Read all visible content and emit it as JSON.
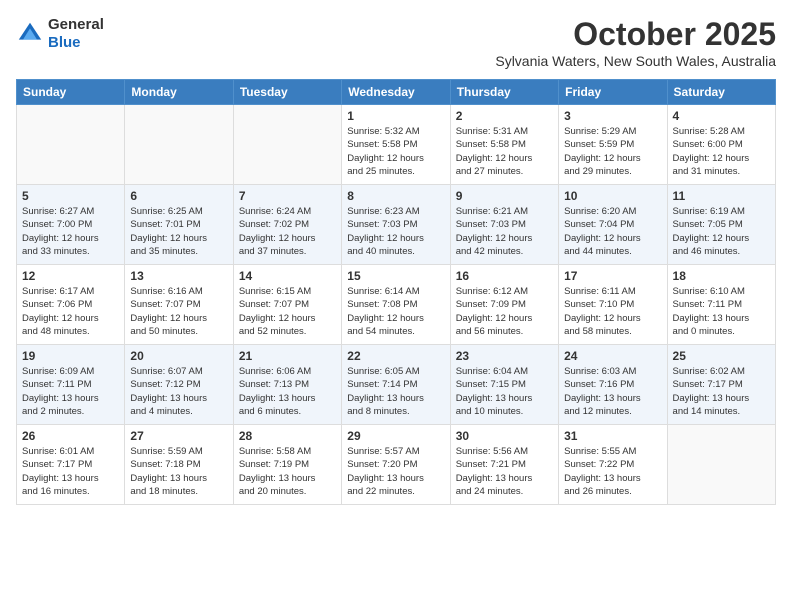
{
  "header": {
    "logo_general": "General",
    "logo_blue": "Blue",
    "month": "October 2025",
    "location": "Sylvania Waters, New South Wales, Australia"
  },
  "weekdays": [
    "Sunday",
    "Monday",
    "Tuesday",
    "Wednesday",
    "Thursday",
    "Friday",
    "Saturday"
  ],
  "weeks": [
    [
      {
        "day": "",
        "info": ""
      },
      {
        "day": "",
        "info": ""
      },
      {
        "day": "",
        "info": ""
      },
      {
        "day": "1",
        "info": "Sunrise: 5:32 AM\nSunset: 5:58 PM\nDaylight: 12 hours\nand 25 minutes."
      },
      {
        "day": "2",
        "info": "Sunrise: 5:31 AM\nSunset: 5:58 PM\nDaylight: 12 hours\nand 27 minutes."
      },
      {
        "day": "3",
        "info": "Sunrise: 5:29 AM\nSunset: 5:59 PM\nDaylight: 12 hours\nand 29 minutes."
      },
      {
        "day": "4",
        "info": "Sunrise: 5:28 AM\nSunset: 6:00 PM\nDaylight: 12 hours\nand 31 minutes."
      }
    ],
    [
      {
        "day": "5",
        "info": "Sunrise: 6:27 AM\nSunset: 7:00 PM\nDaylight: 12 hours\nand 33 minutes."
      },
      {
        "day": "6",
        "info": "Sunrise: 6:25 AM\nSunset: 7:01 PM\nDaylight: 12 hours\nand 35 minutes."
      },
      {
        "day": "7",
        "info": "Sunrise: 6:24 AM\nSunset: 7:02 PM\nDaylight: 12 hours\nand 37 minutes."
      },
      {
        "day": "8",
        "info": "Sunrise: 6:23 AM\nSunset: 7:03 PM\nDaylight: 12 hours\nand 40 minutes."
      },
      {
        "day": "9",
        "info": "Sunrise: 6:21 AM\nSunset: 7:03 PM\nDaylight: 12 hours\nand 42 minutes."
      },
      {
        "day": "10",
        "info": "Sunrise: 6:20 AM\nSunset: 7:04 PM\nDaylight: 12 hours\nand 44 minutes."
      },
      {
        "day": "11",
        "info": "Sunrise: 6:19 AM\nSunset: 7:05 PM\nDaylight: 12 hours\nand 46 minutes."
      }
    ],
    [
      {
        "day": "12",
        "info": "Sunrise: 6:17 AM\nSunset: 7:06 PM\nDaylight: 12 hours\nand 48 minutes."
      },
      {
        "day": "13",
        "info": "Sunrise: 6:16 AM\nSunset: 7:07 PM\nDaylight: 12 hours\nand 50 minutes."
      },
      {
        "day": "14",
        "info": "Sunrise: 6:15 AM\nSunset: 7:07 PM\nDaylight: 12 hours\nand 52 minutes."
      },
      {
        "day": "15",
        "info": "Sunrise: 6:14 AM\nSunset: 7:08 PM\nDaylight: 12 hours\nand 54 minutes."
      },
      {
        "day": "16",
        "info": "Sunrise: 6:12 AM\nSunset: 7:09 PM\nDaylight: 12 hours\nand 56 minutes."
      },
      {
        "day": "17",
        "info": "Sunrise: 6:11 AM\nSunset: 7:10 PM\nDaylight: 12 hours\nand 58 minutes."
      },
      {
        "day": "18",
        "info": "Sunrise: 6:10 AM\nSunset: 7:11 PM\nDaylight: 13 hours\nand 0 minutes."
      }
    ],
    [
      {
        "day": "19",
        "info": "Sunrise: 6:09 AM\nSunset: 7:11 PM\nDaylight: 13 hours\nand 2 minutes."
      },
      {
        "day": "20",
        "info": "Sunrise: 6:07 AM\nSunset: 7:12 PM\nDaylight: 13 hours\nand 4 minutes."
      },
      {
        "day": "21",
        "info": "Sunrise: 6:06 AM\nSunset: 7:13 PM\nDaylight: 13 hours\nand 6 minutes."
      },
      {
        "day": "22",
        "info": "Sunrise: 6:05 AM\nSunset: 7:14 PM\nDaylight: 13 hours\nand 8 minutes."
      },
      {
        "day": "23",
        "info": "Sunrise: 6:04 AM\nSunset: 7:15 PM\nDaylight: 13 hours\nand 10 minutes."
      },
      {
        "day": "24",
        "info": "Sunrise: 6:03 AM\nSunset: 7:16 PM\nDaylight: 13 hours\nand 12 minutes."
      },
      {
        "day": "25",
        "info": "Sunrise: 6:02 AM\nSunset: 7:17 PM\nDaylight: 13 hours\nand 14 minutes."
      }
    ],
    [
      {
        "day": "26",
        "info": "Sunrise: 6:01 AM\nSunset: 7:17 PM\nDaylight: 13 hours\nand 16 minutes."
      },
      {
        "day": "27",
        "info": "Sunrise: 5:59 AM\nSunset: 7:18 PM\nDaylight: 13 hours\nand 18 minutes."
      },
      {
        "day": "28",
        "info": "Sunrise: 5:58 AM\nSunset: 7:19 PM\nDaylight: 13 hours\nand 20 minutes."
      },
      {
        "day": "29",
        "info": "Sunrise: 5:57 AM\nSunset: 7:20 PM\nDaylight: 13 hours\nand 22 minutes."
      },
      {
        "day": "30",
        "info": "Sunrise: 5:56 AM\nSunset: 7:21 PM\nDaylight: 13 hours\nand 24 minutes."
      },
      {
        "day": "31",
        "info": "Sunrise: 5:55 AM\nSunset: 7:22 PM\nDaylight: 13 hours\nand 26 minutes."
      },
      {
        "day": "",
        "info": ""
      }
    ]
  ]
}
